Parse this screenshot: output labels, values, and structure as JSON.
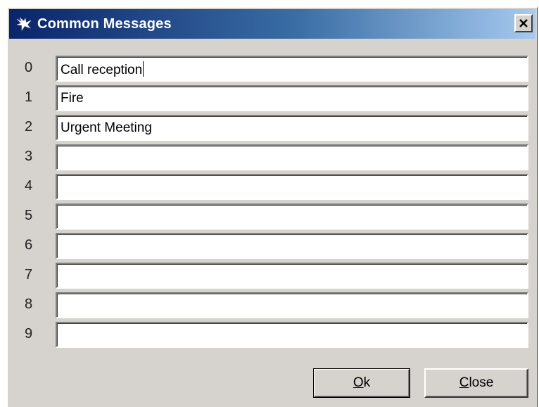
{
  "window": {
    "title": "Common Messages",
    "close_glyph": "×",
    "icon": "bird-icon"
  },
  "messages": [
    {
      "index": "0",
      "value": "Call reception"
    },
    {
      "index": "1",
      "value": "Fire"
    },
    {
      "index": "2",
      "value": "Urgent Meeting"
    },
    {
      "index": "3",
      "value": ""
    },
    {
      "index": "4",
      "value": ""
    },
    {
      "index": "5",
      "value": ""
    },
    {
      "index": "6",
      "value": ""
    },
    {
      "index": "7",
      "value": ""
    },
    {
      "index": "8",
      "value": ""
    },
    {
      "index": "9",
      "value": ""
    }
  ],
  "buttons": {
    "ok": {
      "mnemonic": "O",
      "rest": "k"
    },
    "close": {
      "mnemonic": "C",
      "rest": "lose"
    }
  },
  "colors": {
    "title_gradient_start": "#0a246a",
    "title_gradient_end": "#a6caf0",
    "dialog_face": "#d6d3ce"
  }
}
